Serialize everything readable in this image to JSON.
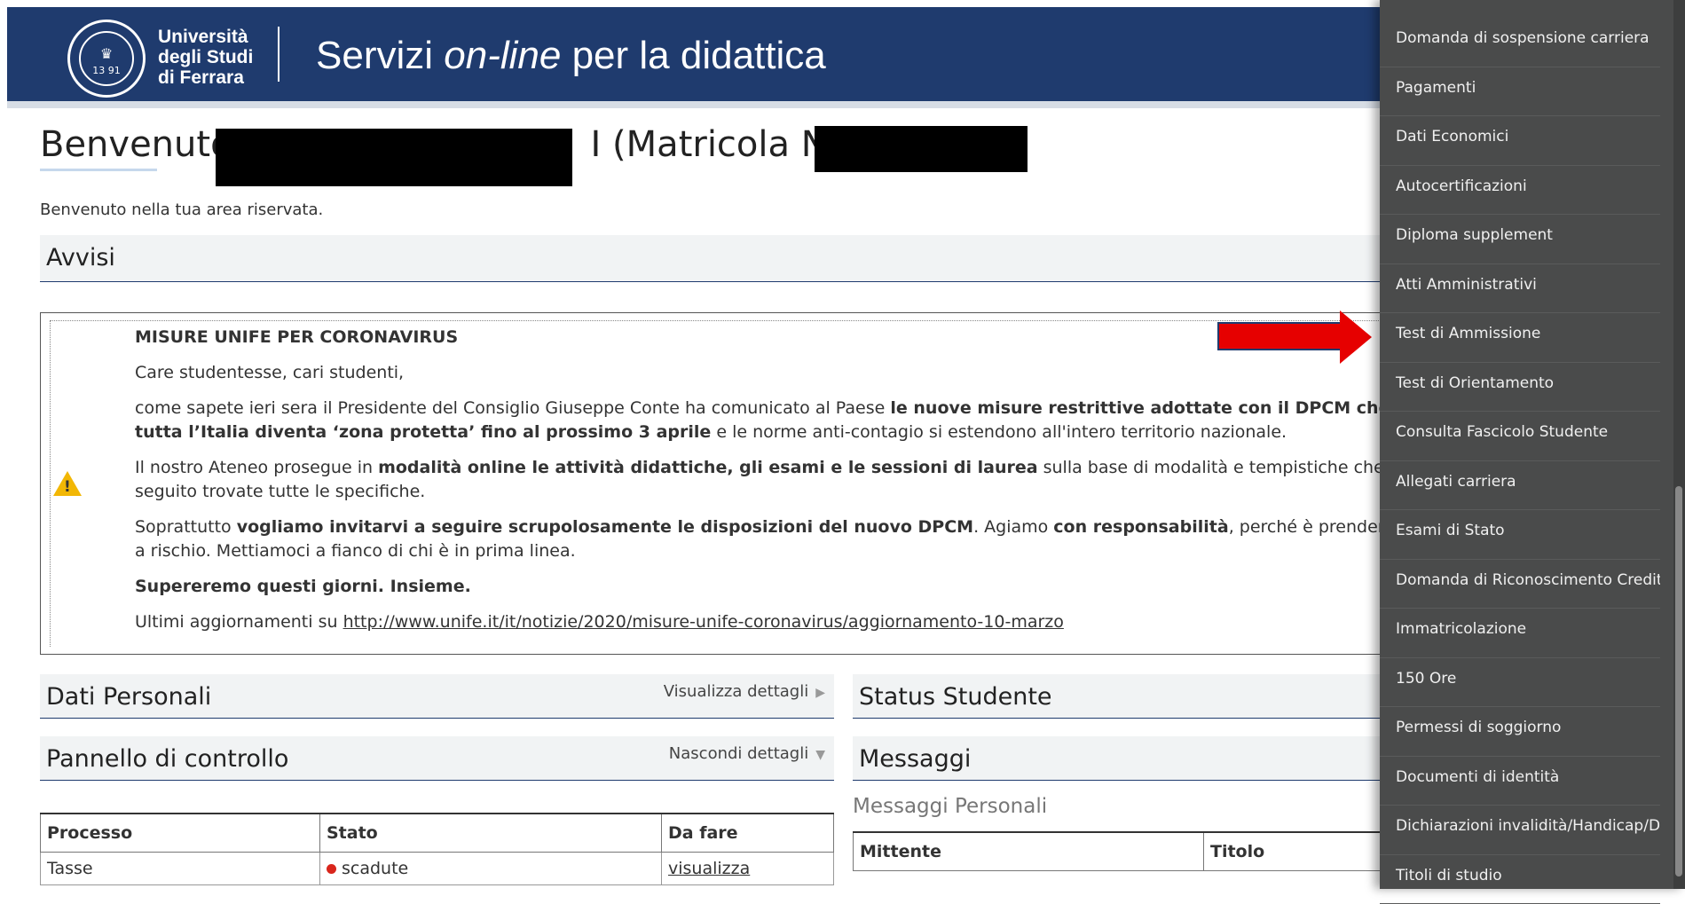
{
  "header": {
    "university": [
      "Università",
      "degli Studi",
      "di Ferrara"
    ],
    "title_prefix": "Servizi ",
    "title_italic": "on-line",
    "title_suffix": " per la didattica",
    "logo_numbers": "13  91"
  },
  "welcome": {
    "title_start": "Benvenuto",
    "title_middle": "I (Matricola N.",
    "subtitle": "Benvenuto nella tua area riservata."
  },
  "avvisi": {
    "title": "Avvisi",
    "heading": "MISURE UNIFE PER CORONAVIRUS",
    "greeting": "Care studentesse, cari studenti,",
    "p1_a": "come sapete ieri sera il Presidente del Consiglio Giuseppe Conte ha comunicato al Paese ",
    "p1_b": "le nuove misure restrittive adottate con il DPCM che da oggi entra in vigo",
    "p1_c": "tutta l’Italia diventa ‘zona protetta’ fino al prossimo 3 aprile",
    "p1_d": " e le norme anti-contagio si estendono all'intero territorio nazionale.",
    "p2_a": "Il nostro Ateneo prosegue in ",
    "p2_b": "modalità online le attività didattiche, gli esami e le sessioni di laurea",
    "p2_c": " sulla base di modalità e tempistiche che vi sono state e continue",
    "p2_d": "seguito trovate tutte le specifiche.",
    "p3_a": "Soprattutto ",
    "p3_b": "vogliamo invitarvi a seguire scrupolosamente le disposizioni del nuovo DPCM",
    "p3_c": ". Agiamo ",
    "p3_d": "con responsabilità",
    "p3_e": ", perché è prendersi cura di tutti. Di noi stes",
    "p3_f": "a rischio. Mettiamoci a fianco di chi è in prima linea.",
    "p4": "Supereremo questi giorni. Insieme.",
    "p5_a": "Ultimi aggiornamenti su ",
    "link": "http://www.unife.it/it/notizie/2020/misure-unife-coronavirus/aggiornamento-10-marzo"
  },
  "dati_personali": {
    "title": "Dati Personali",
    "link": "Visualizza dettagli"
  },
  "status": {
    "title": "Status Studente"
  },
  "pannello": {
    "title": "Pannello di controllo",
    "link": "Nascondi dettagli"
  },
  "messaggi": {
    "title": "Messaggi",
    "sub": "Messaggi Personali",
    "col1": "Mittente",
    "col2": "Titolo"
  },
  "table": {
    "headers": [
      "Processo",
      "Stato",
      "Da fare"
    ],
    "row1": [
      "Tasse",
      "scadute",
      "visualizza"
    ]
  },
  "sidebar": {
    "items": [
      "Domanda di sospensione carriera",
      "Pagamenti",
      "Dati Economici",
      "Autocertificazioni",
      "Diploma supplement",
      "Atti Amministrativi",
      "Test di Ammissione",
      "Test di Orientamento",
      "Consulta Fascicolo Studente",
      "Allegati carriera",
      "Esami di Stato",
      "Domanda di Riconoscimento Crediti",
      "Immatricolazione",
      "150 Ore",
      "Permessi di soggiorno",
      "Documenti di identità",
      "Dichiarazioni invalidità/Handicap/DSA",
      "Titoli di studio"
    ]
  },
  "colors": {
    "header": "#1f3b6e",
    "sidebar": "#4a4b4b",
    "arrow": "#e60000",
    "warning": "#f2b705"
  }
}
